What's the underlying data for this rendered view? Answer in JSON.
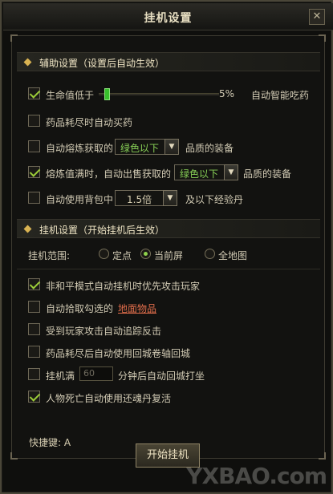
{
  "window": {
    "title": "挂机设置",
    "close_icon": "close-icon"
  },
  "aux": {
    "title": "辅助设置（设置后自动生效）",
    "hp": {
      "label": "生命值低于",
      "value_percent": "5%",
      "slider_fraction": 0.05,
      "suffix": "自动智能吃药",
      "checked": true
    },
    "drug_buy": {
      "label": "药品耗尽时自动买药",
      "checked": false
    },
    "smelt": {
      "prefix": "自动熔炼获取的",
      "select": "绿色以下",
      "suffix": "品质的装备",
      "checked": false
    },
    "sell": {
      "prefix": "熔炼值满时，自动出售获取的",
      "select": "绿色以下",
      "suffix": "品质的装备",
      "checked": true
    },
    "exp_pill": {
      "prefix": "自动使用背包中",
      "select": "1.5倍",
      "suffix": "及以下经验丹",
      "checked": false
    }
  },
  "afk": {
    "title": "挂机设置（开始挂机后生效）",
    "range_label": "挂机范围:",
    "range_options": [
      "定点",
      "当前屏",
      "全地图"
    ],
    "range_selected": 1,
    "pvp": {
      "label": "非和平模式自动挂机时优先攻击玩家",
      "checked": true
    },
    "pickup": {
      "prefix": "自动拾取勾选的",
      "link": "地面物品",
      "checked": false
    },
    "retaliate": {
      "label": "受到玩家攻击自动追踪反击",
      "checked": false
    },
    "return_scroll": {
      "label": "药品耗尽后自动使用回城卷轴回城",
      "checked": false
    },
    "time_return": {
      "prefix": "挂机满",
      "placeholder": "60",
      "suffix": "分钟后自动回城打坐",
      "checked": false
    },
    "revive": {
      "label": "人物死亡自动使用还魂丹复活",
      "checked": true
    }
  },
  "footer": {
    "shortcut": "快捷键: A",
    "start_button": "开始挂机"
  },
  "watermark": "YXBAO.com",
  "colors": {
    "accent_green": "#88d057",
    "link_red": "#e06d4b",
    "diamond_gold": "#d9b352"
  }
}
